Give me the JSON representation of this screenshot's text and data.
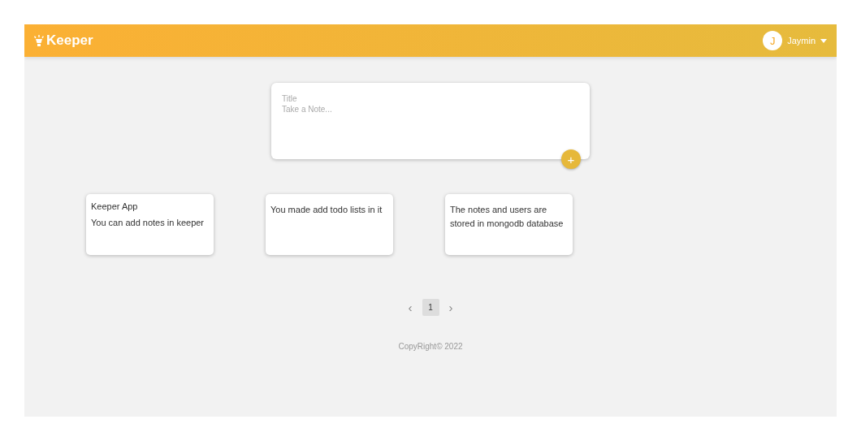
{
  "header": {
    "logo": "Keeper",
    "user": {
      "initial": "J",
      "name": "Jaymin"
    }
  },
  "composer": {
    "title_placeholder": "Title",
    "note_placeholder": "Take a Note...",
    "add_button": "+"
  },
  "notes": [
    {
      "title": "Keeper App",
      "content": "You can add notes in keeper"
    },
    {
      "content": "You made add todo lists in it"
    },
    {
      "content": "The notes and users are stored in mongodb database"
    }
  ],
  "pagination": {
    "prev": "‹",
    "next": "›",
    "pages": [
      {
        "label": "1",
        "selected": true
      }
    ]
  },
  "footer": "CopyRight© 2022"
}
